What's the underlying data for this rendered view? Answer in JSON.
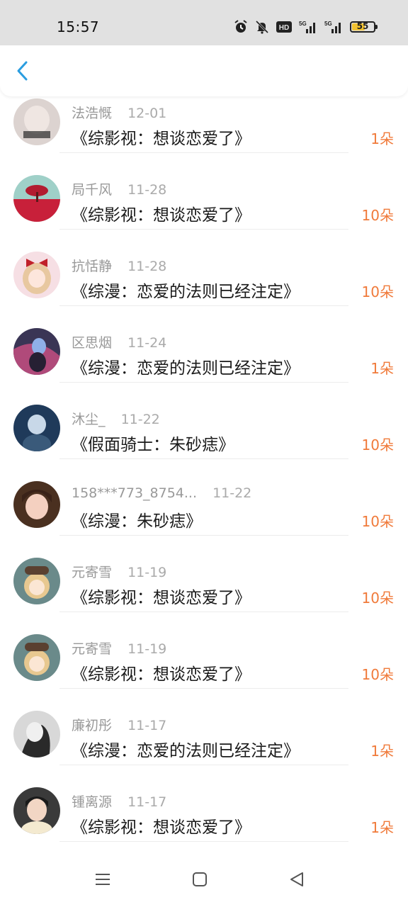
{
  "status_bar": {
    "time": "15:57",
    "battery": "55",
    "battery_level": 0.55,
    "icons": [
      "alarm-icon",
      "mute-icon",
      "hd-icon",
      "signal-5g-icon",
      "signal-5g-icon",
      "battery-icon"
    ]
  },
  "header": {
    "back_icon": "chevron-left-icon",
    "accent": "#2a9de0"
  },
  "records": [
    {
      "name": "法浩慨",
      "date": "12-01",
      "title": "《综影视：想谈恋爱了》",
      "amount": "1朵"
    },
    {
      "name": "局千风",
      "date": "11-28",
      "title": "《综影视：想谈恋爱了》",
      "amount": "10朵"
    },
    {
      "name": "抗恬静",
      "date": "11-28",
      "title": "《综漫：恋爱的法则已经注定》",
      "amount": "10朵"
    },
    {
      "name": "区思烟",
      "date": "11-24",
      "title": "《综漫：恋爱的法则已经注定》",
      "amount": "1朵"
    },
    {
      "name": "沐尘_",
      "date": "11-22",
      "title": "《假面骑士：朱砂痣》",
      "amount": "10朵"
    },
    {
      "name": "158***773_8754...",
      "date": "11-22",
      "title": "《综漫：朱砂痣》",
      "amount": "10朵"
    },
    {
      "name": "元寄雪",
      "date": "11-19",
      "title": "《综影视：想谈恋爱了》",
      "amount": "10朵"
    },
    {
      "name": "元寄雪",
      "date": "11-19",
      "title": "《综影视：想谈恋爱了》",
      "amount": "10朵"
    },
    {
      "name": "廉初彤",
      "date": "11-17",
      "title": "《综漫：恋爱的法则已经注定》",
      "amount": "1朵"
    },
    {
      "name": "锺离源",
      "date": "11-17",
      "title": "《综影视：想谈恋爱了》",
      "amount": "1朵"
    }
  ],
  "colors": {
    "amount": "#f07a3a",
    "meta": "#999999",
    "title": "#1a1a1a"
  },
  "nav_bar": {
    "icons": [
      "menu-icon",
      "home-icon",
      "back-triangle-icon"
    ]
  }
}
